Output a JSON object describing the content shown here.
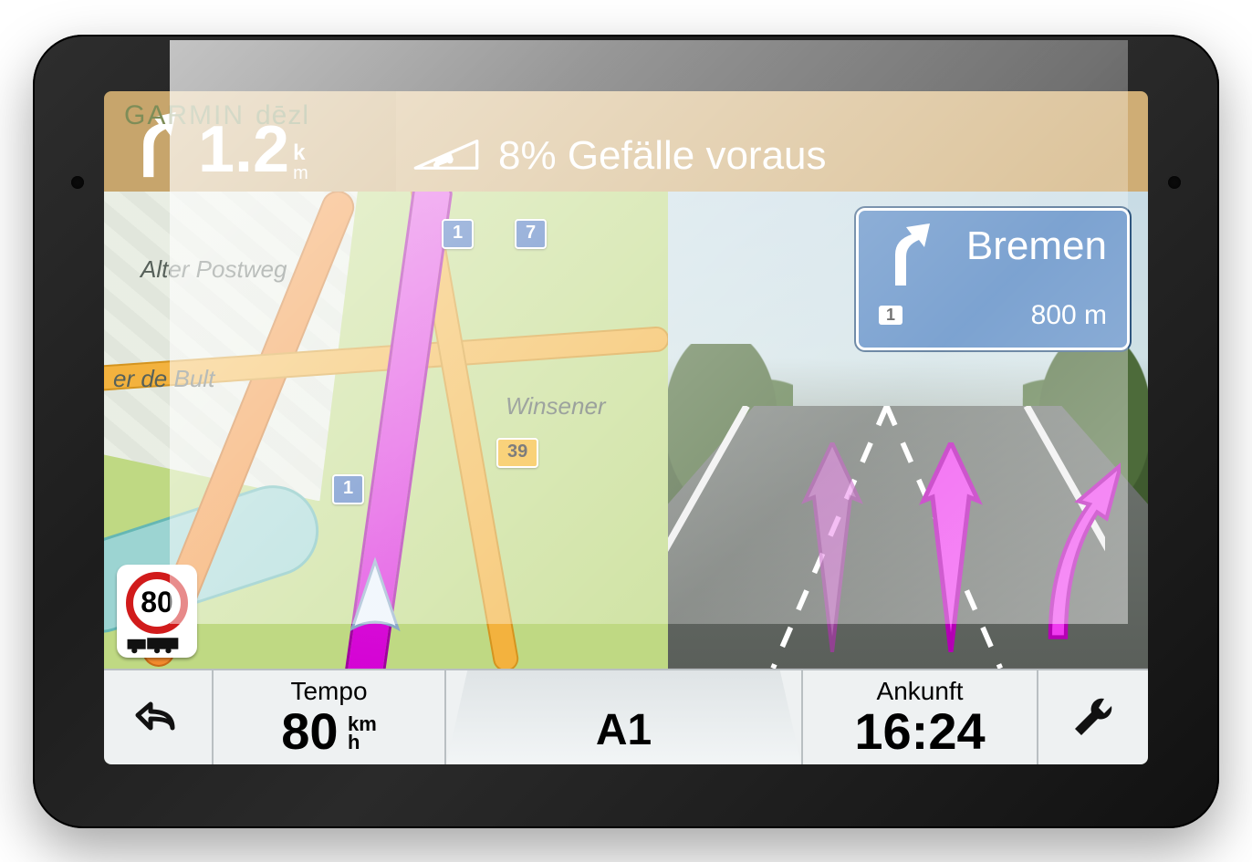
{
  "brand": {
    "name": "GARMIN",
    "model": "dēzl"
  },
  "top": {
    "distance_value": "1.2",
    "distance_unit_top": "k",
    "distance_unit_bottom": "m",
    "alert_text": "8% Gefälle voraus"
  },
  "map": {
    "labels": {
      "street1": "Alter Postweg",
      "street2": "er de Bult",
      "town": "Winsener"
    },
    "shields": {
      "a": "1",
      "b": "7",
      "c": "39",
      "d": "1"
    },
    "speed_limit": "80"
  },
  "junction": {
    "destination": "Bremen",
    "shield": "1",
    "distance": "800 m"
  },
  "bottom": {
    "speed_label": "Tempo",
    "speed_value": "80",
    "speed_unit_top": "km",
    "speed_unit_bottom": "h",
    "road_name": "A1",
    "eta_label": "Ankunft",
    "eta_value": "16:24"
  }
}
